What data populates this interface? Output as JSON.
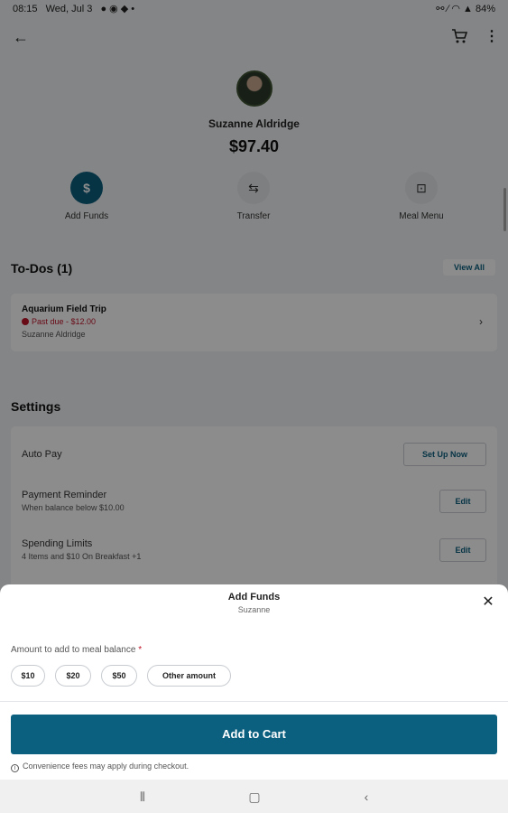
{
  "status_bar": {
    "time": "08:15",
    "date": "Wed, Jul 3",
    "battery": "84%"
  },
  "profile": {
    "name": "Suzanne Aldridge",
    "balance": "$97.40"
  },
  "actions": [
    {
      "label": "Add Funds",
      "icon": "dollar-icon",
      "glyph": "$"
    },
    {
      "label": "Transfer",
      "icon": "transfer-icon",
      "glyph": "⇆"
    },
    {
      "label": "Meal Menu",
      "icon": "meal-menu-icon",
      "glyph": "⊡"
    }
  ],
  "todos": {
    "title": "To-Dos (1)",
    "view_all": "View All",
    "items": [
      {
        "title": "Aquarium Field Trip",
        "status": "Past due - $12.00",
        "student": "Suzanne Aldridge"
      }
    ]
  },
  "settings": {
    "title": "Settings",
    "rows": [
      {
        "label": "Auto Pay",
        "sub": "",
        "button": "Set Up Now"
      },
      {
        "label": "Payment Reminder",
        "sub": "When balance below $10.00",
        "button": "Edit"
      },
      {
        "label": "Spending Limits",
        "sub": "4 Items and $10 On Breakfast +1",
        "button": "Edit"
      }
    ]
  },
  "sheet": {
    "title": "Add Funds",
    "subtitle": "Suzanne",
    "amount_label": "Amount to add to meal balance",
    "required_mark": "*",
    "chips": [
      "$10",
      "$20",
      "$50",
      "Other amount"
    ],
    "add_to_cart": "Add to Cart",
    "fee_note": "Convenience fees may apply during checkout."
  },
  "colors": {
    "primary": "#0b5f7f",
    "danger": "#c0152b"
  }
}
